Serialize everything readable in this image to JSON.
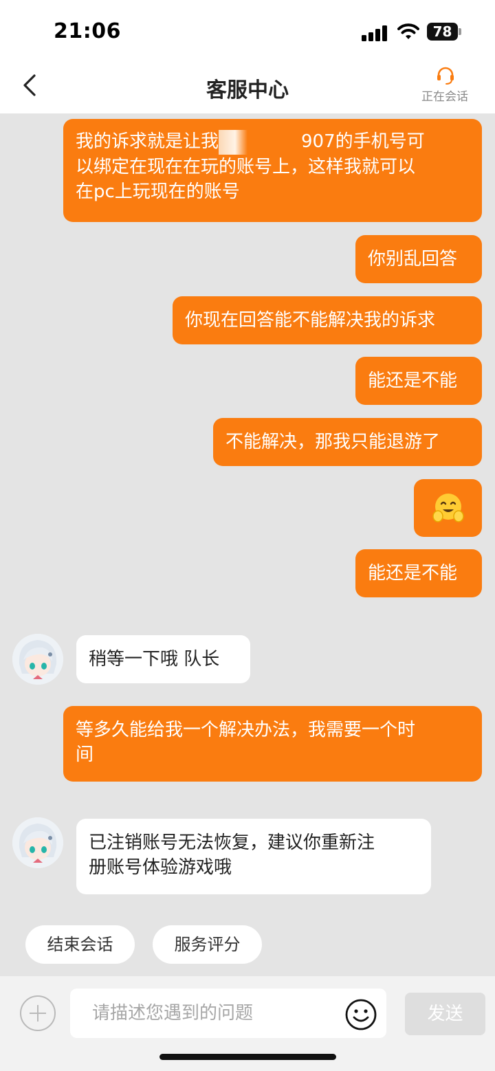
{
  "status_bar": {
    "time": "21:06",
    "battery": "78"
  },
  "header": {
    "title": "客服中心",
    "agent_status": "正在会话"
  },
  "messages": [
    {
      "from": "user",
      "lines": [
        "我的诉求就是让我",
        "907的手机号可",
        "以绑定在现在在玩的账号上，这样我就可以",
        "在pc上玩现在的账号"
      ],
      "redacted": true
    },
    {
      "from": "user",
      "text": "你别乱回答"
    },
    {
      "from": "user",
      "text": "你现在回答能不能解决我的诉求"
    },
    {
      "from": "user",
      "text": "能还是不能"
    },
    {
      "from": "user",
      "text": "不能解决，那我只能退游了"
    },
    {
      "from": "user",
      "emoji": "hugging-face"
    },
    {
      "from": "user",
      "text": "能还是不能"
    },
    {
      "from": "agent",
      "text": "稍等一下哦 队长"
    },
    {
      "from": "user",
      "lines": [
        "等多久能给我一个解决办法，我需要一个时",
        "间"
      ]
    },
    {
      "from": "agent",
      "lines": [
        "已注销账号无法恢复，建议你重新注",
        "册账号体验游戏哦"
      ]
    }
  ],
  "quick_actions": {
    "end_chat": "结束会话",
    "rate_service": "服务评分"
  },
  "input": {
    "placeholder": "请描述您遇到的问题",
    "send_label": "发送"
  },
  "colors": {
    "accent": "#fa7c10",
    "chat_bg": "#e4e4e4",
    "send_disabled": "#dedede"
  }
}
